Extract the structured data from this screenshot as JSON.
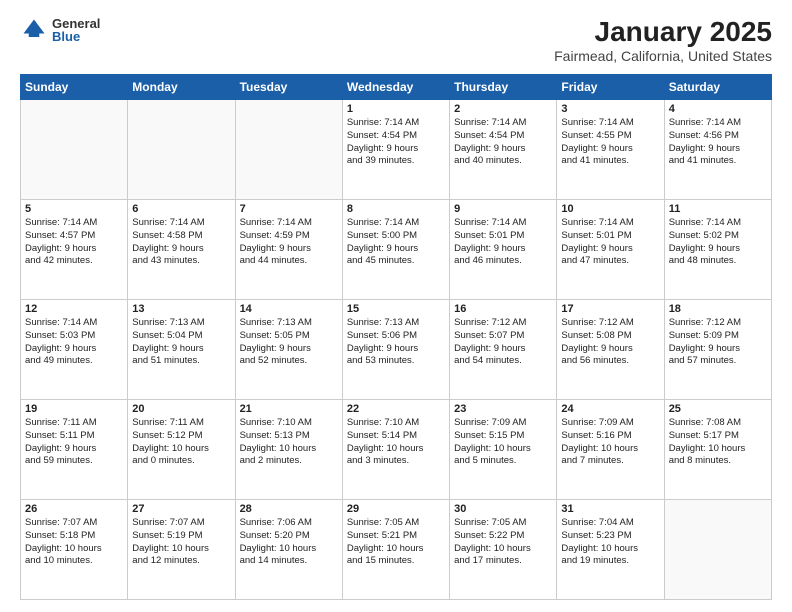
{
  "header": {
    "logo_general": "General",
    "logo_blue": "Blue",
    "month_title": "January 2025",
    "location": "Fairmead, California, United States"
  },
  "days_of_week": [
    "Sunday",
    "Monday",
    "Tuesday",
    "Wednesday",
    "Thursday",
    "Friday",
    "Saturday"
  ],
  "weeks": [
    [
      {
        "day": "",
        "info": ""
      },
      {
        "day": "",
        "info": ""
      },
      {
        "day": "",
        "info": ""
      },
      {
        "day": "1",
        "info": "Sunrise: 7:14 AM\nSunset: 4:54 PM\nDaylight: 9 hours\nand 39 minutes."
      },
      {
        "day": "2",
        "info": "Sunrise: 7:14 AM\nSunset: 4:54 PM\nDaylight: 9 hours\nand 40 minutes."
      },
      {
        "day": "3",
        "info": "Sunrise: 7:14 AM\nSunset: 4:55 PM\nDaylight: 9 hours\nand 41 minutes."
      },
      {
        "day": "4",
        "info": "Sunrise: 7:14 AM\nSunset: 4:56 PM\nDaylight: 9 hours\nand 41 minutes."
      }
    ],
    [
      {
        "day": "5",
        "info": "Sunrise: 7:14 AM\nSunset: 4:57 PM\nDaylight: 9 hours\nand 42 minutes."
      },
      {
        "day": "6",
        "info": "Sunrise: 7:14 AM\nSunset: 4:58 PM\nDaylight: 9 hours\nand 43 minutes."
      },
      {
        "day": "7",
        "info": "Sunrise: 7:14 AM\nSunset: 4:59 PM\nDaylight: 9 hours\nand 44 minutes."
      },
      {
        "day": "8",
        "info": "Sunrise: 7:14 AM\nSunset: 5:00 PM\nDaylight: 9 hours\nand 45 minutes."
      },
      {
        "day": "9",
        "info": "Sunrise: 7:14 AM\nSunset: 5:01 PM\nDaylight: 9 hours\nand 46 minutes."
      },
      {
        "day": "10",
        "info": "Sunrise: 7:14 AM\nSunset: 5:01 PM\nDaylight: 9 hours\nand 47 minutes."
      },
      {
        "day": "11",
        "info": "Sunrise: 7:14 AM\nSunset: 5:02 PM\nDaylight: 9 hours\nand 48 minutes."
      }
    ],
    [
      {
        "day": "12",
        "info": "Sunrise: 7:14 AM\nSunset: 5:03 PM\nDaylight: 9 hours\nand 49 minutes."
      },
      {
        "day": "13",
        "info": "Sunrise: 7:13 AM\nSunset: 5:04 PM\nDaylight: 9 hours\nand 51 minutes."
      },
      {
        "day": "14",
        "info": "Sunrise: 7:13 AM\nSunset: 5:05 PM\nDaylight: 9 hours\nand 52 minutes."
      },
      {
        "day": "15",
        "info": "Sunrise: 7:13 AM\nSunset: 5:06 PM\nDaylight: 9 hours\nand 53 minutes."
      },
      {
        "day": "16",
        "info": "Sunrise: 7:12 AM\nSunset: 5:07 PM\nDaylight: 9 hours\nand 54 minutes."
      },
      {
        "day": "17",
        "info": "Sunrise: 7:12 AM\nSunset: 5:08 PM\nDaylight: 9 hours\nand 56 minutes."
      },
      {
        "day": "18",
        "info": "Sunrise: 7:12 AM\nSunset: 5:09 PM\nDaylight: 9 hours\nand 57 minutes."
      }
    ],
    [
      {
        "day": "19",
        "info": "Sunrise: 7:11 AM\nSunset: 5:11 PM\nDaylight: 9 hours\nand 59 minutes."
      },
      {
        "day": "20",
        "info": "Sunrise: 7:11 AM\nSunset: 5:12 PM\nDaylight: 10 hours\nand 0 minutes."
      },
      {
        "day": "21",
        "info": "Sunrise: 7:10 AM\nSunset: 5:13 PM\nDaylight: 10 hours\nand 2 minutes."
      },
      {
        "day": "22",
        "info": "Sunrise: 7:10 AM\nSunset: 5:14 PM\nDaylight: 10 hours\nand 3 minutes."
      },
      {
        "day": "23",
        "info": "Sunrise: 7:09 AM\nSunset: 5:15 PM\nDaylight: 10 hours\nand 5 minutes."
      },
      {
        "day": "24",
        "info": "Sunrise: 7:09 AM\nSunset: 5:16 PM\nDaylight: 10 hours\nand 7 minutes."
      },
      {
        "day": "25",
        "info": "Sunrise: 7:08 AM\nSunset: 5:17 PM\nDaylight: 10 hours\nand 8 minutes."
      }
    ],
    [
      {
        "day": "26",
        "info": "Sunrise: 7:07 AM\nSunset: 5:18 PM\nDaylight: 10 hours\nand 10 minutes."
      },
      {
        "day": "27",
        "info": "Sunrise: 7:07 AM\nSunset: 5:19 PM\nDaylight: 10 hours\nand 12 minutes."
      },
      {
        "day": "28",
        "info": "Sunrise: 7:06 AM\nSunset: 5:20 PM\nDaylight: 10 hours\nand 14 minutes."
      },
      {
        "day": "29",
        "info": "Sunrise: 7:05 AM\nSunset: 5:21 PM\nDaylight: 10 hours\nand 15 minutes."
      },
      {
        "day": "30",
        "info": "Sunrise: 7:05 AM\nSunset: 5:22 PM\nDaylight: 10 hours\nand 17 minutes."
      },
      {
        "day": "31",
        "info": "Sunrise: 7:04 AM\nSunset: 5:23 PM\nDaylight: 10 hours\nand 19 minutes."
      },
      {
        "day": "",
        "info": ""
      }
    ]
  ]
}
